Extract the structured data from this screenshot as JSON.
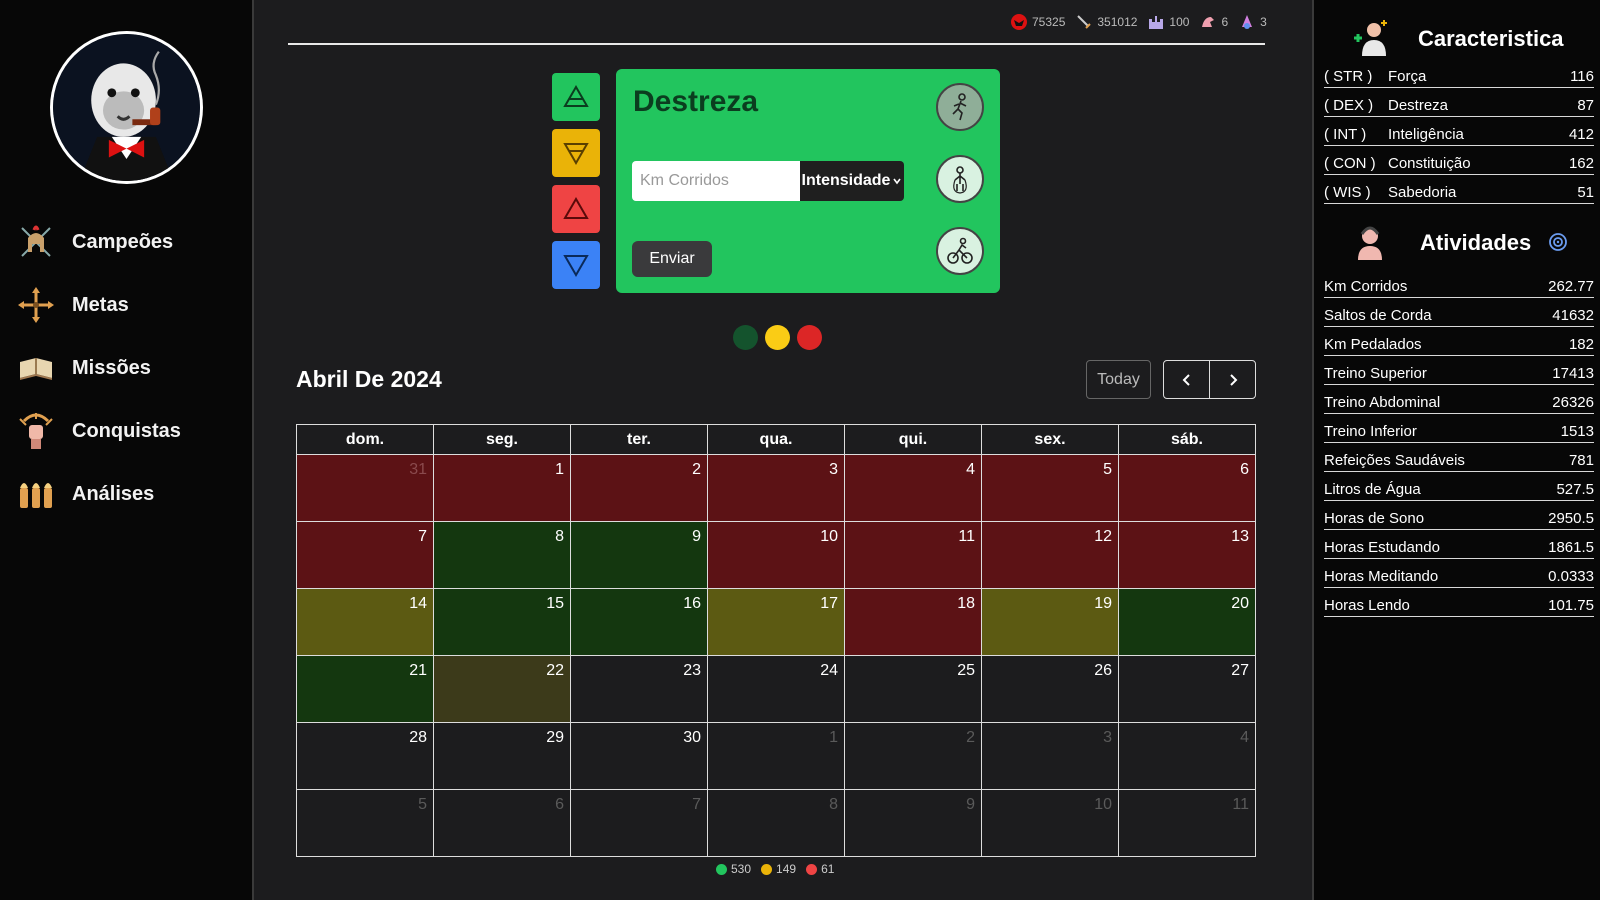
{
  "sidebar": {
    "nav": [
      {
        "label": "Campeões",
        "icon": "spartan-helmet-icon"
      },
      {
        "label": "Metas",
        "icon": "crosshair-arrows-icon"
      },
      {
        "label": "Missões",
        "icon": "open-book-icon"
      },
      {
        "label": "Conquistas",
        "icon": "fist-trophy-icon"
      },
      {
        "label": "Análises",
        "icon": "bullets-icon"
      }
    ]
  },
  "topstats": [
    {
      "icon": "demon-mask-icon",
      "value": "75325"
    },
    {
      "icon": "sword-icon",
      "value": "351012"
    },
    {
      "icon": "castle-icon",
      "value": "100"
    },
    {
      "icon": "dragon-icon",
      "value": "6"
    },
    {
      "icon": "wizard-icon",
      "value": "3"
    }
  ],
  "card": {
    "title": "Destreza",
    "input_placeholder": "Km Corridos",
    "select_label": "Intensidade",
    "send_label": "Enviar"
  },
  "calendar": {
    "title": "Abril De 2024",
    "today_label": "Today",
    "weekdays": [
      "dom.",
      "seg.",
      "ter.",
      "qua.",
      "qui.",
      "sex.",
      "sáb."
    ],
    "weeks": [
      [
        [
          "31",
          "red",
          true
        ],
        [
          "1",
          "red",
          false
        ],
        [
          "2",
          "red",
          false
        ],
        [
          "3",
          "red",
          false
        ],
        [
          "4",
          "red",
          false
        ],
        [
          "5",
          "red",
          false
        ],
        [
          "6",
          "red",
          false
        ]
      ],
      [
        [
          "7",
          "red",
          false
        ],
        [
          "8",
          "green",
          false
        ],
        [
          "9",
          "green",
          false
        ],
        [
          "10",
          "red",
          false
        ],
        [
          "11",
          "red",
          false
        ],
        [
          "12",
          "red",
          false
        ],
        [
          "13",
          "red",
          false
        ]
      ],
      [
        [
          "14",
          "yellow",
          false
        ],
        [
          "15",
          "green",
          false
        ],
        [
          "16",
          "green",
          false
        ],
        [
          "17",
          "yellow",
          false
        ],
        [
          "18",
          "red",
          false
        ],
        [
          "19",
          "yellow",
          false
        ],
        [
          "20",
          "green",
          false
        ]
      ],
      [
        [
          "21",
          "green",
          false
        ],
        [
          "22",
          "olive",
          false
        ],
        [
          "23",
          "none",
          false
        ],
        [
          "24",
          "none",
          false
        ],
        [
          "25",
          "none",
          false
        ],
        [
          "26",
          "none",
          false
        ],
        [
          "27",
          "none",
          false
        ]
      ],
      [
        [
          "28",
          "none",
          false
        ],
        [
          "29",
          "none",
          false
        ],
        [
          "30",
          "none",
          false
        ],
        [
          "1",
          "none",
          true
        ],
        [
          "2",
          "none",
          true
        ],
        [
          "3",
          "none",
          true
        ],
        [
          "4",
          "none",
          true
        ]
      ],
      [
        [
          "5",
          "none",
          true
        ],
        [
          "6",
          "none",
          true
        ],
        [
          "7",
          "none",
          true
        ],
        [
          "8",
          "none",
          true
        ],
        [
          "9",
          "none",
          true
        ],
        [
          "10",
          "none",
          true
        ],
        [
          "11",
          "none",
          true
        ]
      ]
    ],
    "legend": [
      {
        "color": "#22c55e",
        "value": "530"
      },
      {
        "color": "#eab308",
        "value": "149"
      },
      {
        "color": "#ef4444",
        "value": "61"
      }
    ]
  },
  "right": {
    "char_title": "Caracteristica",
    "attributes": [
      {
        "abbr": "( STR )",
        "name": "Força",
        "value": "116"
      },
      {
        "abbr": "( DEX )",
        "name": "Destreza",
        "value": "87"
      },
      {
        "abbr": "( INT )",
        "name": "Inteligência",
        "value": "412"
      },
      {
        "abbr": "( CON )",
        "name": "Constituição",
        "value": "162"
      },
      {
        "abbr": "( WIS )",
        "name": "Sabedoria",
        "value": "51"
      }
    ],
    "act_title": "Atividades",
    "activities": [
      {
        "name": "Km Corridos",
        "value": "262.77"
      },
      {
        "name": "Saltos de Corda",
        "value": "41632"
      },
      {
        "name": "Km Pedalados",
        "value": "182"
      },
      {
        "name": "Treino Superior",
        "value": "17413"
      },
      {
        "name": "Treino Abdominal",
        "value": "26326"
      },
      {
        "name": "Treino Inferior",
        "value": "1513"
      },
      {
        "name": "Refeições Saudáveis",
        "value": "781"
      },
      {
        "name": "Litros de Água",
        "value": "527.5"
      },
      {
        "name": "Horas de Sono",
        "value": "2950.5"
      },
      {
        "name": "Horas Estudando",
        "value": "1861.5"
      },
      {
        "name": "Horas Meditando",
        "value": "0.0333"
      },
      {
        "name": "Horas Lendo",
        "value": "101.75"
      }
    ]
  }
}
